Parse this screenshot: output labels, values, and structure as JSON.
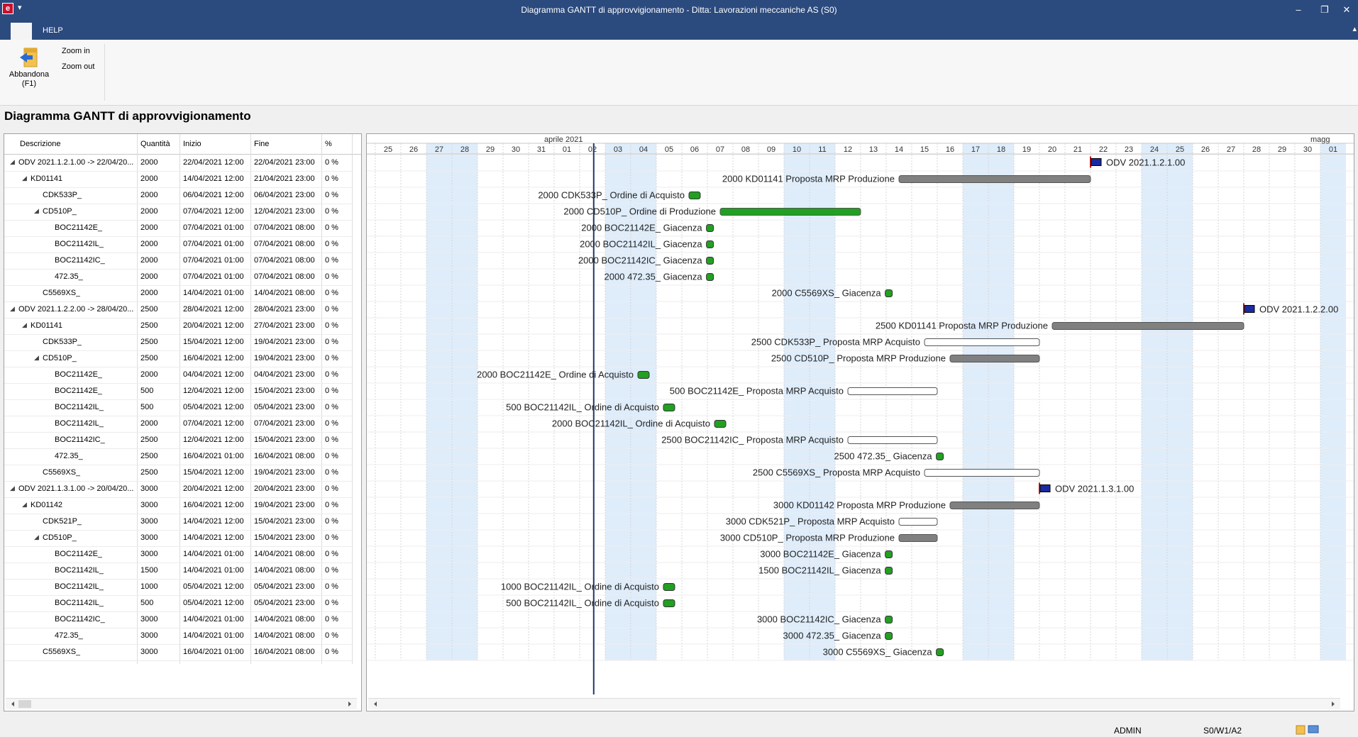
{
  "window": {
    "title": "Diagramma GANTT di approvvigionamento - Ditta: Lavorazioni meccaniche AS (S0)",
    "quick_access": "▾",
    "minimize": "–",
    "restore": "❐",
    "close": "✕"
  },
  "ribbon": {
    "tab_help": "HELP",
    "collapse": "▴",
    "exit_label": "Abbandona (F1)",
    "zoom_in": "Zoom in",
    "zoom_out": "Zoom out"
  },
  "page_title": "Diagramma GANTT di approvvigionamento",
  "grid": {
    "columns": [
      "Descrizione",
      "Quantità",
      "Inizio",
      "Fine",
      "%"
    ],
    "rows": [
      {
        "desc": "ODV 2021.1.2.1.00 -> 22/04/20...",
        "level": 0,
        "toggle": "◢",
        "qty": "2000",
        "start": "22/04/2021 12:00",
        "end": "22/04/2021 23:00",
        "pct": "0 %"
      },
      {
        "desc": "KD01141",
        "level": 1,
        "toggle": "◢",
        "qty": "2000",
        "start": "14/04/2021 12:00",
        "end": "21/04/2021 23:00",
        "pct": "0 %"
      },
      {
        "desc": "CDK533P_",
        "level": 2,
        "toggle": "",
        "qty": "2000",
        "start": "06/04/2021 12:00",
        "end": "06/04/2021 23:00",
        "pct": "0 %"
      },
      {
        "desc": "CD510P_",
        "level": 2,
        "toggle": "◢",
        "qty": "2000",
        "start": "07/04/2021 12:00",
        "end": "12/04/2021 23:00",
        "pct": "0 %"
      },
      {
        "desc": "BOC21142E_",
        "level": 3,
        "toggle": "",
        "qty": "2000",
        "start": "07/04/2021 01:00",
        "end": "07/04/2021 08:00",
        "pct": "0 %"
      },
      {
        "desc": "BOC21142IL_",
        "level": 3,
        "toggle": "",
        "qty": "2000",
        "start": "07/04/2021 01:00",
        "end": "07/04/2021 08:00",
        "pct": "0 %"
      },
      {
        "desc": "BOC21142IC_",
        "level": 3,
        "toggle": "",
        "qty": "2000",
        "start": "07/04/2021 01:00",
        "end": "07/04/2021 08:00",
        "pct": "0 %"
      },
      {
        "desc": "472.35_",
        "level": 3,
        "toggle": "",
        "qty": "2000",
        "start": "07/04/2021 01:00",
        "end": "07/04/2021 08:00",
        "pct": "0 %"
      },
      {
        "desc": "C5569XS_",
        "level": 2,
        "toggle": "",
        "qty": "2000",
        "start": "14/04/2021 01:00",
        "end": "14/04/2021 08:00",
        "pct": "0 %"
      },
      {
        "desc": "ODV 2021.1.2.2.00 -> 28/04/20...",
        "level": 0,
        "toggle": "◢",
        "qty": "2500",
        "start": "28/04/2021 12:00",
        "end": "28/04/2021 23:00",
        "pct": "0 %"
      },
      {
        "desc": "KD01141",
        "level": 1,
        "toggle": "◢",
        "qty": "2500",
        "start": "20/04/2021 12:00",
        "end": "27/04/2021 23:00",
        "pct": "0 %"
      },
      {
        "desc": "CDK533P_",
        "level": 2,
        "toggle": "",
        "qty": "2500",
        "start": "15/04/2021 12:00",
        "end": "19/04/2021 23:00",
        "pct": "0 %"
      },
      {
        "desc": "CD510P_",
        "level": 2,
        "toggle": "◢",
        "qty": "2500",
        "start": "16/04/2021 12:00",
        "end": "19/04/2021 23:00",
        "pct": "0 %"
      },
      {
        "desc": "BOC21142E_",
        "level": 3,
        "toggle": "",
        "qty": "2000",
        "start": "04/04/2021 12:00",
        "end": "04/04/2021 23:00",
        "pct": "0 %"
      },
      {
        "desc": "BOC21142E_",
        "level": 3,
        "toggle": "",
        "qty": "500",
        "start": "12/04/2021 12:00",
        "end": "15/04/2021 23:00",
        "pct": "0 %"
      },
      {
        "desc": "BOC21142IL_",
        "level": 3,
        "toggle": "",
        "qty": "500",
        "start": "05/04/2021 12:00",
        "end": "05/04/2021 23:00",
        "pct": "0 %"
      },
      {
        "desc": "BOC21142IL_",
        "level": 3,
        "toggle": "",
        "qty": "2000",
        "start": "07/04/2021 12:00",
        "end": "07/04/2021 23:00",
        "pct": "0 %"
      },
      {
        "desc": "BOC21142IC_",
        "level": 3,
        "toggle": "",
        "qty": "2500",
        "start": "12/04/2021 12:00",
        "end": "15/04/2021 23:00",
        "pct": "0 %"
      },
      {
        "desc": "472.35_",
        "level": 3,
        "toggle": "",
        "qty": "2500",
        "start": "16/04/2021 01:00",
        "end": "16/04/2021 08:00",
        "pct": "0 %"
      },
      {
        "desc": "C5569XS_",
        "level": 2,
        "toggle": "",
        "qty": "2500",
        "start": "15/04/2021 12:00",
        "end": "19/04/2021 23:00",
        "pct": "0 %"
      },
      {
        "desc": "ODV 2021.1.3.1.00 -> 20/04/20...",
        "level": 0,
        "toggle": "◢",
        "qty": "3000",
        "start": "20/04/2021 12:00",
        "end": "20/04/2021 23:00",
        "pct": "0 %"
      },
      {
        "desc": "KD01142",
        "level": 1,
        "toggle": "◢",
        "qty": "3000",
        "start": "16/04/2021 12:00",
        "end": "19/04/2021 23:00",
        "pct": "0 %"
      },
      {
        "desc": "CDK521P_",
        "level": 2,
        "toggle": "",
        "qty": "3000",
        "start": "14/04/2021 12:00",
        "end": "15/04/2021 23:00",
        "pct": "0 %"
      },
      {
        "desc": "CD510P_",
        "level": 2,
        "toggle": "◢",
        "qty": "3000",
        "start": "14/04/2021 12:00",
        "end": "15/04/2021 23:00",
        "pct": "0 %"
      },
      {
        "desc": "BOC21142E_",
        "level": 3,
        "toggle": "",
        "qty": "3000",
        "start": "14/04/2021 01:00",
        "end": "14/04/2021 08:00",
        "pct": "0 %"
      },
      {
        "desc": "BOC21142IL_",
        "level": 3,
        "toggle": "",
        "qty": "1500",
        "start": "14/04/2021 01:00",
        "end": "14/04/2021 08:00",
        "pct": "0 %"
      },
      {
        "desc": "BOC21142IL_",
        "level": 3,
        "toggle": "",
        "qty": "1000",
        "start": "05/04/2021 12:00",
        "end": "05/04/2021 23:00",
        "pct": "0 %"
      },
      {
        "desc": "BOC21142IL_",
        "level": 3,
        "toggle": "",
        "qty": "500",
        "start": "05/04/2021 12:00",
        "end": "05/04/2021 23:00",
        "pct": "0 %"
      },
      {
        "desc": "BOC21142IC_",
        "level": 3,
        "toggle": "",
        "qty": "3000",
        "start": "14/04/2021 01:00",
        "end": "14/04/2021 08:00",
        "pct": "0 %"
      },
      {
        "desc": "472.35_",
        "level": 3,
        "toggle": "",
        "qty": "3000",
        "start": "14/04/2021 01:00",
        "end": "14/04/2021 08:00",
        "pct": "0 %"
      },
      {
        "desc": "C5569XS_",
        "level": 2,
        "toggle": "",
        "qty": "3000",
        "start": "16/04/2021 01:00",
        "end": "16/04/2021 08:00",
        "pct": "0 %"
      }
    ]
  },
  "gantt": {
    "month_labels": [
      {
        "text": "aprile 2021",
        "day_index": 7
      },
      {
        "text": "magg",
        "day_index": 37
      }
    ],
    "days": [
      "25",
      "26",
      "27",
      "28",
      "29",
      "30",
      "31",
      "01",
      "02",
      "03",
      "04",
      "05",
      "06",
      "07",
      "08",
      "09",
      "10",
      "11",
      "12",
      "13",
      "14",
      "15",
      "16",
      "17",
      "18",
      "19",
      "20",
      "21",
      "22",
      "23",
      "24",
      "25",
      "26",
      "27",
      "28",
      "29",
      "30",
      "01"
    ],
    "weekend_day_indices": [
      2,
      3,
      9,
      10,
      16,
      17,
      23,
      24,
      30,
      31,
      37
    ],
    "today_day": 8.55,
    "colors": {
      "green": "#22a022",
      "gray": "#808080",
      "red_flag": "#cc1111",
      "blue_flag": "#1a2aa0",
      "weekend": "#dfedfb",
      "today": "#1f3a6e"
    },
    "tasks": [
      {
        "row": 0,
        "type": "order",
        "start": 28.0,
        "label": "ODV 2021.1.2.1.00"
      },
      {
        "row": 1,
        "type": "bar-gray",
        "start": 20.5,
        "end": 28.0,
        "label": "2000 KD01141 Proposta MRP Produzione"
      },
      {
        "row": 2,
        "type": "point",
        "start": 12.5,
        "label": "2000 CDK533P_ Ordine di Acquisto"
      },
      {
        "row": 3,
        "type": "bar-green",
        "start": 13.5,
        "end": 19.0,
        "label": "2000 CD510P_ Ordine di Produzione"
      },
      {
        "row": 4,
        "type": "point-small",
        "start": 13.1,
        "label": "2000 BOC21142E_ Giacenza"
      },
      {
        "row": 5,
        "type": "point-small",
        "start": 13.1,
        "label": "2000 BOC21142IL_ Giacenza"
      },
      {
        "row": 6,
        "type": "point-small",
        "start": 13.1,
        "label": "2000 BOC21142IC_ Giacenza"
      },
      {
        "row": 7,
        "type": "point-small",
        "start": 13.1,
        "label": "2000 472.35_ Giacenza"
      },
      {
        "row": 8,
        "type": "point-small",
        "start": 20.1,
        "label": "2000 C5569XS_ Giacenza"
      },
      {
        "row": 9,
        "type": "order",
        "start": 34.0,
        "label": "ODV 2021.1.2.2.00"
      },
      {
        "row": 10,
        "type": "bar-gray",
        "start": 26.5,
        "end": 34.0,
        "label": "2500 KD01141 Proposta MRP Produzione"
      },
      {
        "row": 11,
        "type": "bar-white",
        "start": 21.5,
        "end": 26.0,
        "label": "2500 CDK533P_ Proposta MRP Acquisto"
      },
      {
        "row": 12,
        "type": "bar-gray",
        "start": 22.5,
        "end": 26.0,
        "label": "2500 CD510P_ Proposta MRP Produzione"
      },
      {
        "row": 13,
        "type": "point",
        "start": 10.5,
        "label": "2000 BOC21142E_ Ordine di Acquisto"
      },
      {
        "row": 14,
        "type": "bar-white",
        "start": 18.5,
        "end": 22.0,
        "label": "500 BOC21142E_ Proposta MRP Acquisto"
      },
      {
        "row": 15,
        "type": "point",
        "start": 11.5,
        "label": "500 BOC21142IL_ Ordine di Acquisto"
      },
      {
        "row": 16,
        "type": "point",
        "start": 13.5,
        "label": "2000 BOC21142IL_ Ordine di Acquisto"
      },
      {
        "row": 17,
        "type": "bar-white",
        "start": 18.5,
        "end": 22.0,
        "label": "2500 BOC21142IC_ Proposta MRP Acquisto"
      },
      {
        "row": 18,
        "type": "point-small",
        "start": 22.1,
        "label": "2500 472.35_ Giacenza"
      },
      {
        "row": 19,
        "type": "bar-white",
        "start": 21.5,
        "end": 26.0,
        "label": "2500 C5569XS_ Proposta MRP Acquisto"
      },
      {
        "row": 20,
        "type": "order",
        "start": 26.0,
        "label": "ODV 2021.1.3.1.00"
      },
      {
        "row": 21,
        "type": "bar-gray",
        "start": 22.5,
        "end": 26.0,
        "label": "3000 KD01142 Proposta MRP Produzione"
      },
      {
        "row": 22,
        "type": "bar-white",
        "start": 20.5,
        "end": 22.0,
        "label": "3000 CDK521P_ Proposta MRP Acquisto"
      },
      {
        "row": 23,
        "type": "bar-gray",
        "start": 20.5,
        "end": 22.0,
        "label": "3000 CD510P_ Proposta MRP Produzione"
      },
      {
        "row": 24,
        "type": "point-small",
        "start": 20.1,
        "label": "3000 BOC21142E_ Giacenza"
      },
      {
        "row": 25,
        "type": "point-small",
        "start": 20.1,
        "label": "1500 BOC21142IL_ Giacenza"
      },
      {
        "row": 26,
        "type": "point",
        "start": 11.5,
        "label": "1000 BOC21142IL_ Ordine di Acquisto"
      },
      {
        "row": 27,
        "type": "point",
        "start": 11.5,
        "label": "500 BOC21142IL_ Ordine di Acquisto"
      },
      {
        "row": 28,
        "type": "point-small",
        "start": 20.1,
        "label": "3000 BOC21142IC_ Giacenza"
      },
      {
        "row": 29,
        "type": "point-small",
        "start": 20.1,
        "label": "3000 472.35_ Giacenza"
      },
      {
        "row": 30,
        "type": "point-small",
        "start": 22.1,
        "label": "3000 C5569XS_ Giacenza"
      }
    ]
  },
  "status": {
    "user": "ADMIN",
    "location": "S0/W1/A2"
  }
}
